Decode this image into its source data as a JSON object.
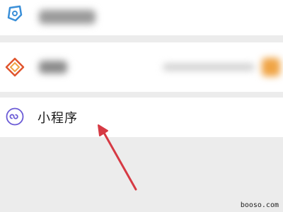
{
  "rows": {
    "top": {
      "icon": "settings-icon"
    },
    "middle": {
      "icon": "app-diamond-icon"
    },
    "mini_program": {
      "label": "小程序",
      "icon": "link-loop-icon"
    }
  },
  "annotation": {
    "arrow": "red-arrow",
    "color": "#d63a44"
  },
  "watermark": "booso.com",
  "colors": {
    "background": "#ececec",
    "row": "#ffffff",
    "icon_purple": "#6b5bd6",
    "icon_orange": "#f0a445"
  }
}
